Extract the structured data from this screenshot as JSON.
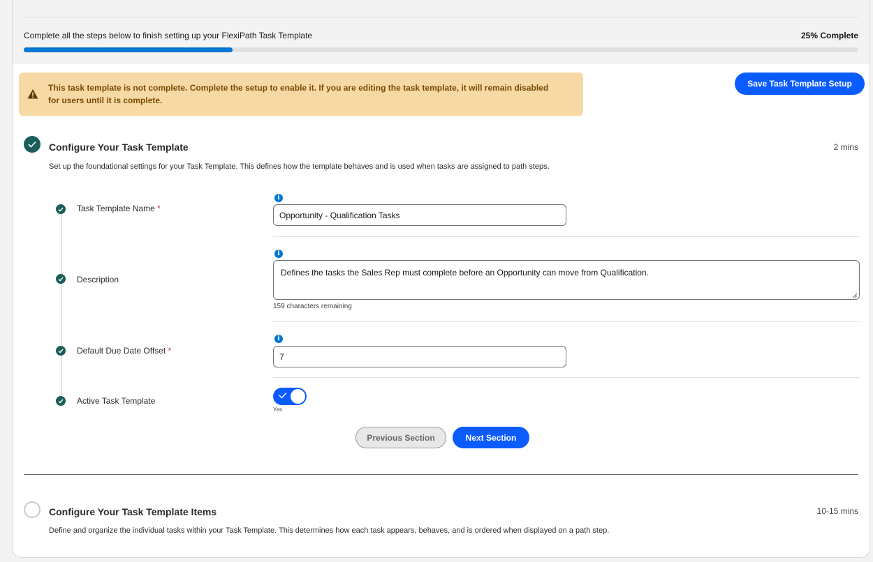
{
  "progress": {
    "text": "Complete all the steps below to finish setting up your FlexiPath Task Template",
    "percent_label": "25% Complete",
    "percent": 25
  },
  "warning": {
    "line1": "This task template is not complete. Complete the setup to enable it. If you are editing the task template, it will remain disabled",
    "line2": "for users until it is complete."
  },
  "actions": {
    "save_label": "Save Task Template Setup"
  },
  "section1": {
    "title": "Configure Your Task Template",
    "time": "2 mins",
    "description": "Set up the foundational settings for your Task Template. This defines how the template behaves and is used when tasks are assigned to path steps.",
    "status": "complete",
    "fields": {
      "name_label": "Task Template Name",
      "name_value": "Opportunity - Qualification Tasks",
      "description_label": "Description",
      "description_value": "Defines the tasks the Sales Rep must complete before an Opportunity can move from Qualification.",
      "description_helper": "159 characters remaining",
      "offset_label": "Default Due Date Offset",
      "offset_value": "7",
      "active_label": "Active Task Template",
      "active_value": "Yes",
      "required_mark": "*",
      "info_glyph": "i"
    },
    "prev_label": "Previous Section",
    "next_label": "Next Section"
  },
  "section2": {
    "title": "Configure Your Task Template Items",
    "time": "10-15 mins",
    "description": "Define and organize the individual tasks within your Task Template. This determines how each task appears, behaves, and is ordered when displayed on a path step.",
    "status": "incomplete"
  },
  "colors": {
    "brand_blue": "#0b5cff",
    "progress_blue": "#0176d3",
    "complete_teal": "#1b5e5a",
    "warning_bg": "#f6d9a5",
    "required_red": "#c23934"
  }
}
